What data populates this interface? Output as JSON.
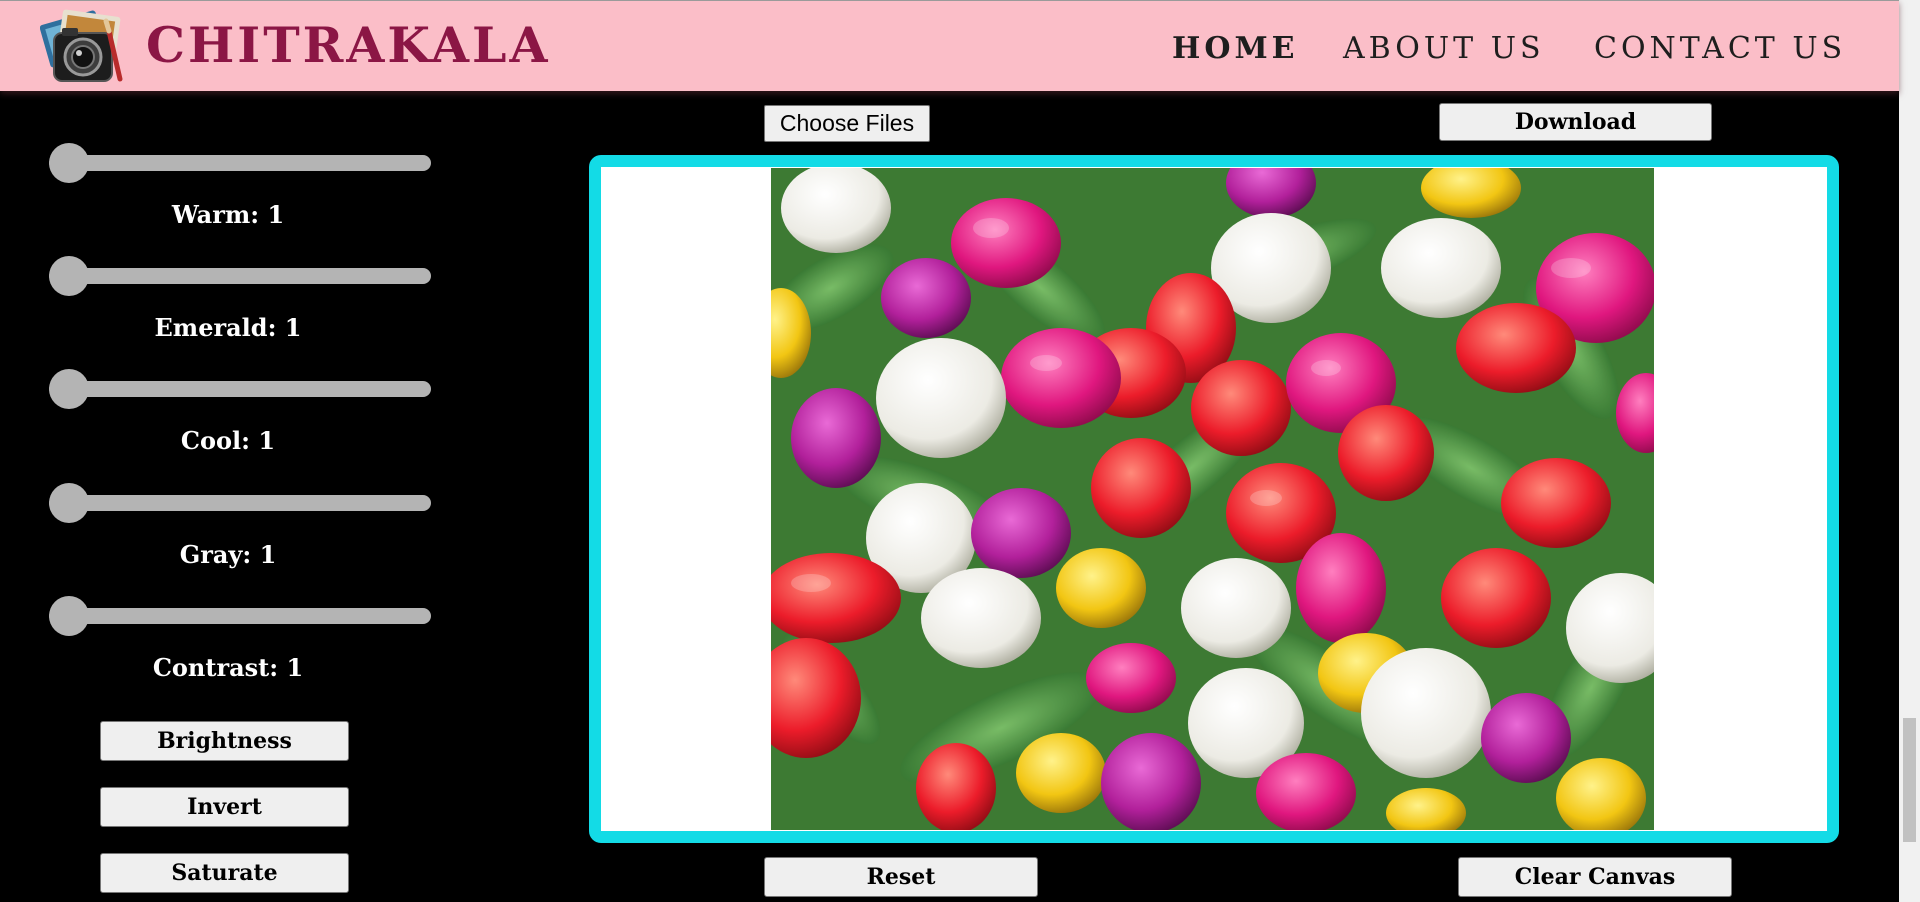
{
  "header": {
    "brand": "CHITRAKALA",
    "nav": {
      "home": "HOME",
      "about": "ABOUT US",
      "contact": "CONTACT US"
    }
  },
  "sliders": [
    {
      "label": "Warm: 1",
      "value": 1
    },
    {
      "label": "Emerald: 1",
      "value": 1
    },
    {
      "label": "Cool: 1",
      "value": 1
    },
    {
      "label": "Gray: 1",
      "value": 1
    },
    {
      "label": "Contrast: 1",
      "value": 1
    }
  ],
  "buttons": {
    "brightness": "Brightness",
    "invert": "Invert",
    "saturate": "Saturate",
    "choose_files": "Choose Files",
    "download": "Download",
    "reset": "Reset",
    "clear_canvas": "Clear Canvas"
  },
  "colors": {
    "header_bg": "#fbbec8",
    "brand": "#8b1645",
    "canvas_border": "#13dbe6",
    "slider": "#b4b4b4"
  },
  "icons": {
    "logo": "camera-photos-logo-icon"
  }
}
